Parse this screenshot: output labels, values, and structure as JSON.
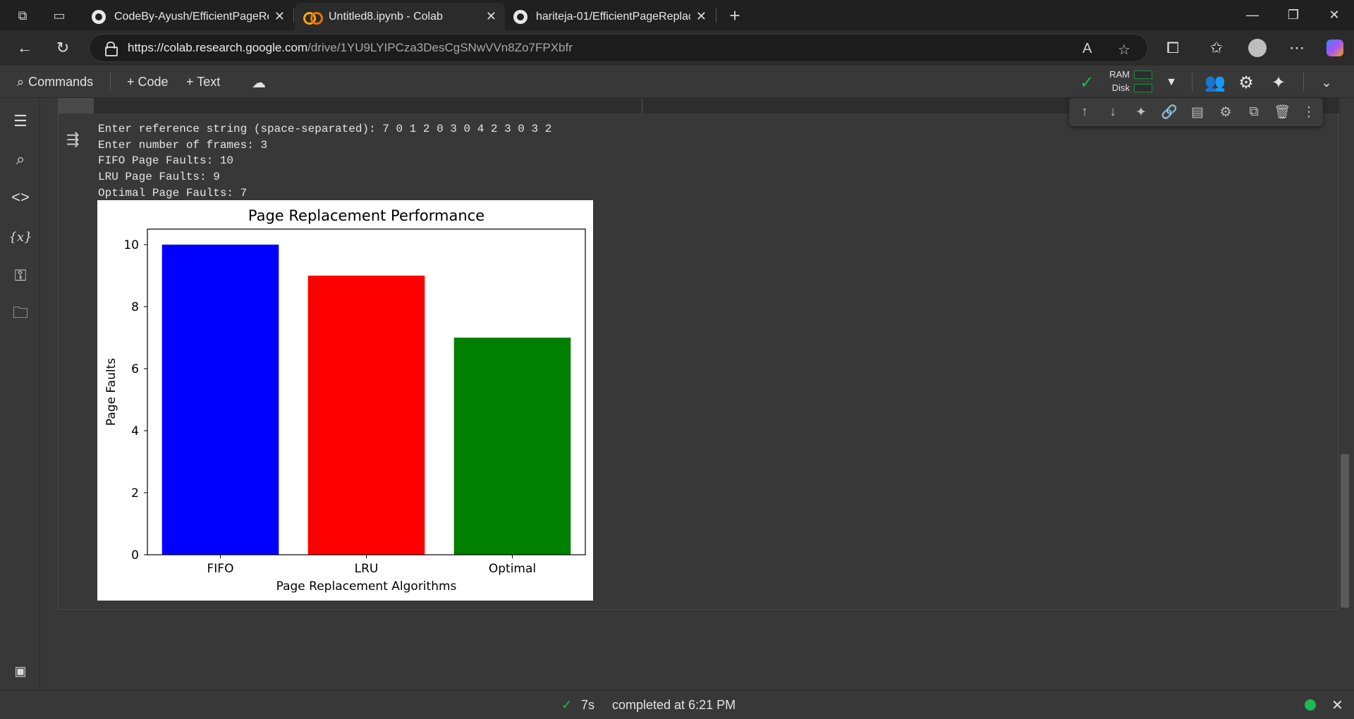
{
  "browser": {
    "tabs": [
      {
        "title": "CodeBy-Ayush/EfficientPageRepla",
        "favicon": "github-icon",
        "active": false
      },
      {
        "title": "Untitled8.ipynb - Colab",
        "favicon": "colab-icon",
        "active": true
      },
      {
        "title": "hariteja-01/EfficientPageReplacem",
        "favicon": "github-icon",
        "active": false
      }
    ],
    "new_tab": "+",
    "url_host": "https://colab.research.google.com",
    "url_path": "/drive/1YU9LYIPCza3DesCgSNwVVn8Zo7FPXbfr"
  },
  "colab_toolbar": {
    "commands_label": "Commands",
    "code_label": "+ Code",
    "text_label": "+ Text",
    "ram_label": "RAM",
    "disk_label": "Disk"
  },
  "cell_output": {
    "lines": [
      "Enter reference string (space-separated): 7 0 1 2 0 3 0 4 2 3 0 3 2",
      "Enter number of frames: 3",
      "FIFO Page Faults: 10",
      "LRU Page Faults: 9",
      "Optimal Page Faults: 7"
    ]
  },
  "chart_data": {
    "type": "bar",
    "title": "Page Replacement Performance",
    "xlabel": "Page Replacement Algorithms",
    "ylabel": "Page Faults",
    "categories": [
      "FIFO",
      "LRU",
      "Optimal"
    ],
    "values": [
      10,
      9,
      7
    ],
    "colors": [
      "#0000ff",
      "#ff0000",
      "#008000"
    ],
    "ylim": [
      0,
      10.5
    ],
    "yticks": [
      0,
      2,
      4,
      6,
      8,
      10
    ],
    "grid": false
  },
  "status": {
    "duration": "7s",
    "completed_text": "completed at 6:21 PM"
  }
}
